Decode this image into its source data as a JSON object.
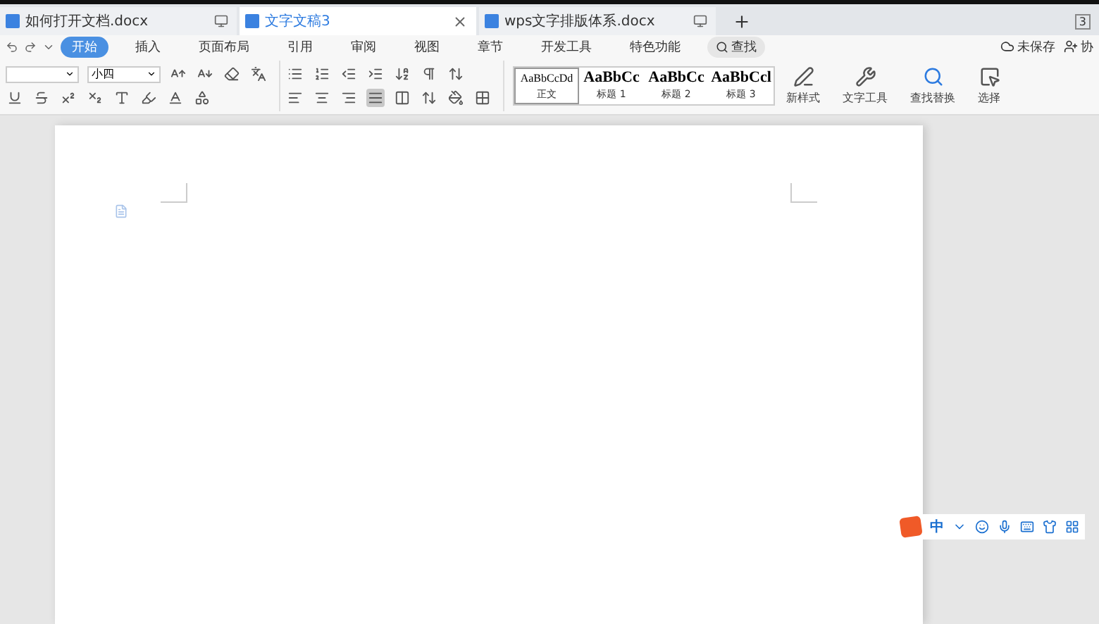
{
  "tabs": [
    {
      "label": "如何打开文档.docx",
      "selected": false
    },
    {
      "label": "文字文稿3",
      "selected": true
    },
    {
      "label": "wps文字排版体系.docx",
      "selected": false
    }
  ],
  "window_count": "3",
  "menu": [
    {
      "label": "开始",
      "selected": true
    },
    {
      "label": "插入",
      "selected": false
    },
    {
      "label": "页面布局",
      "selected": false
    },
    {
      "label": "引用",
      "selected": false
    },
    {
      "label": "审阅",
      "selected": false
    },
    {
      "label": "视图",
      "selected": false
    },
    {
      "label": "章节",
      "selected": false
    },
    {
      "label": "开发工具",
      "selected": false
    },
    {
      "label": "特色功能",
      "selected": false
    }
  ],
  "search": {
    "label": "查找"
  },
  "save_status": "未保存",
  "share": "协",
  "font": {
    "size": "小四"
  },
  "alignment": [
    {
      "selected": false
    },
    {
      "selected": false
    },
    {
      "selected": false
    },
    {
      "selected": true
    },
    {
      "selected": false
    }
  ],
  "styles": [
    {
      "preview": "AaBbCcDd",
      "label": "正文",
      "selected": true
    },
    {
      "preview": "AaBbCc",
      "label": "标题 1",
      "selected": false
    },
    {
      "preview": "AaBbCc",
      "label": "标题 2",
      "selected": false
    },
    {
      "preview": "AaBbCcl",
      "label": "标题 3",
      "selected": false
    }
  ],
  "big_buttons": [
    {
      "label": "新样式"
    },
    {
      "label": "文字工具"
    },
    {
      "label": "查找替换"
    },
    {
      "label": "选择"
    }
  ],
  "ime": {
    "mode": "中"
  }
}
